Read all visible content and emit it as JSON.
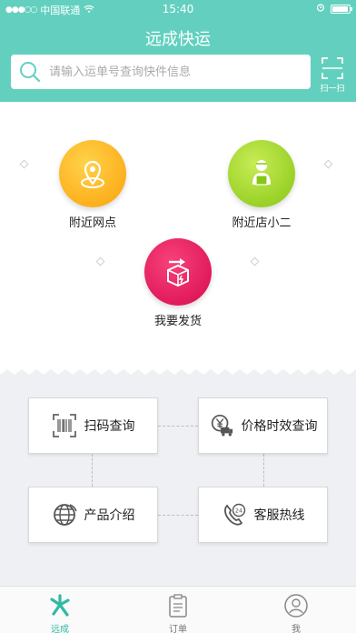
{
  "status": {
    "carrier": "中国联通",
    "time": "15:40"
  },
  "header": {
    "title": "远成快运",
    "search_placeholder": "请输入运单号查询快件信息",
    "scan_label": "扫一扫"
  },
  "features": [
    {
      "label": "附近网点",
      "icon": "location-pin-icon"
    },
    {
      "label": "附近店小二",
      "icon": "courier-icon"
    },
    {
      "label": "我要发货",
      "icon": "package-send-icon"
    }
  ],
  "services": [
    {
      "label": "扫码查询",
      "icon": "barcode-scan-icon"
    },
    {
      "label": "价格时效查询",
      "icon": "price-delivery-icon"
    },
    {
      "label": "产品介绍",
      "icon": "globe-icon"
    },
    {
      "label": "客服热线",
      "icon": "24h-phone-icon"
    }
  ],
  "tabbar": [
    {
      "label": "远成",
      "icon": "home-logo-icon",
      "active": true
    },
    {
      "label": "订单",
      "icon": "order-clipboard-icon",
      "active": false
    },
    {
      "label": "我",
      "icon": "profile-icon",
      "active": false
    }
  ],
  "colors": {
    "accent": "#63d0bf",
    "orange": "#fba20a",
    "green": "#86c614",
    "pink": "#d80a4e",
    "active_tab": "#2fbaa4"
  }
}
